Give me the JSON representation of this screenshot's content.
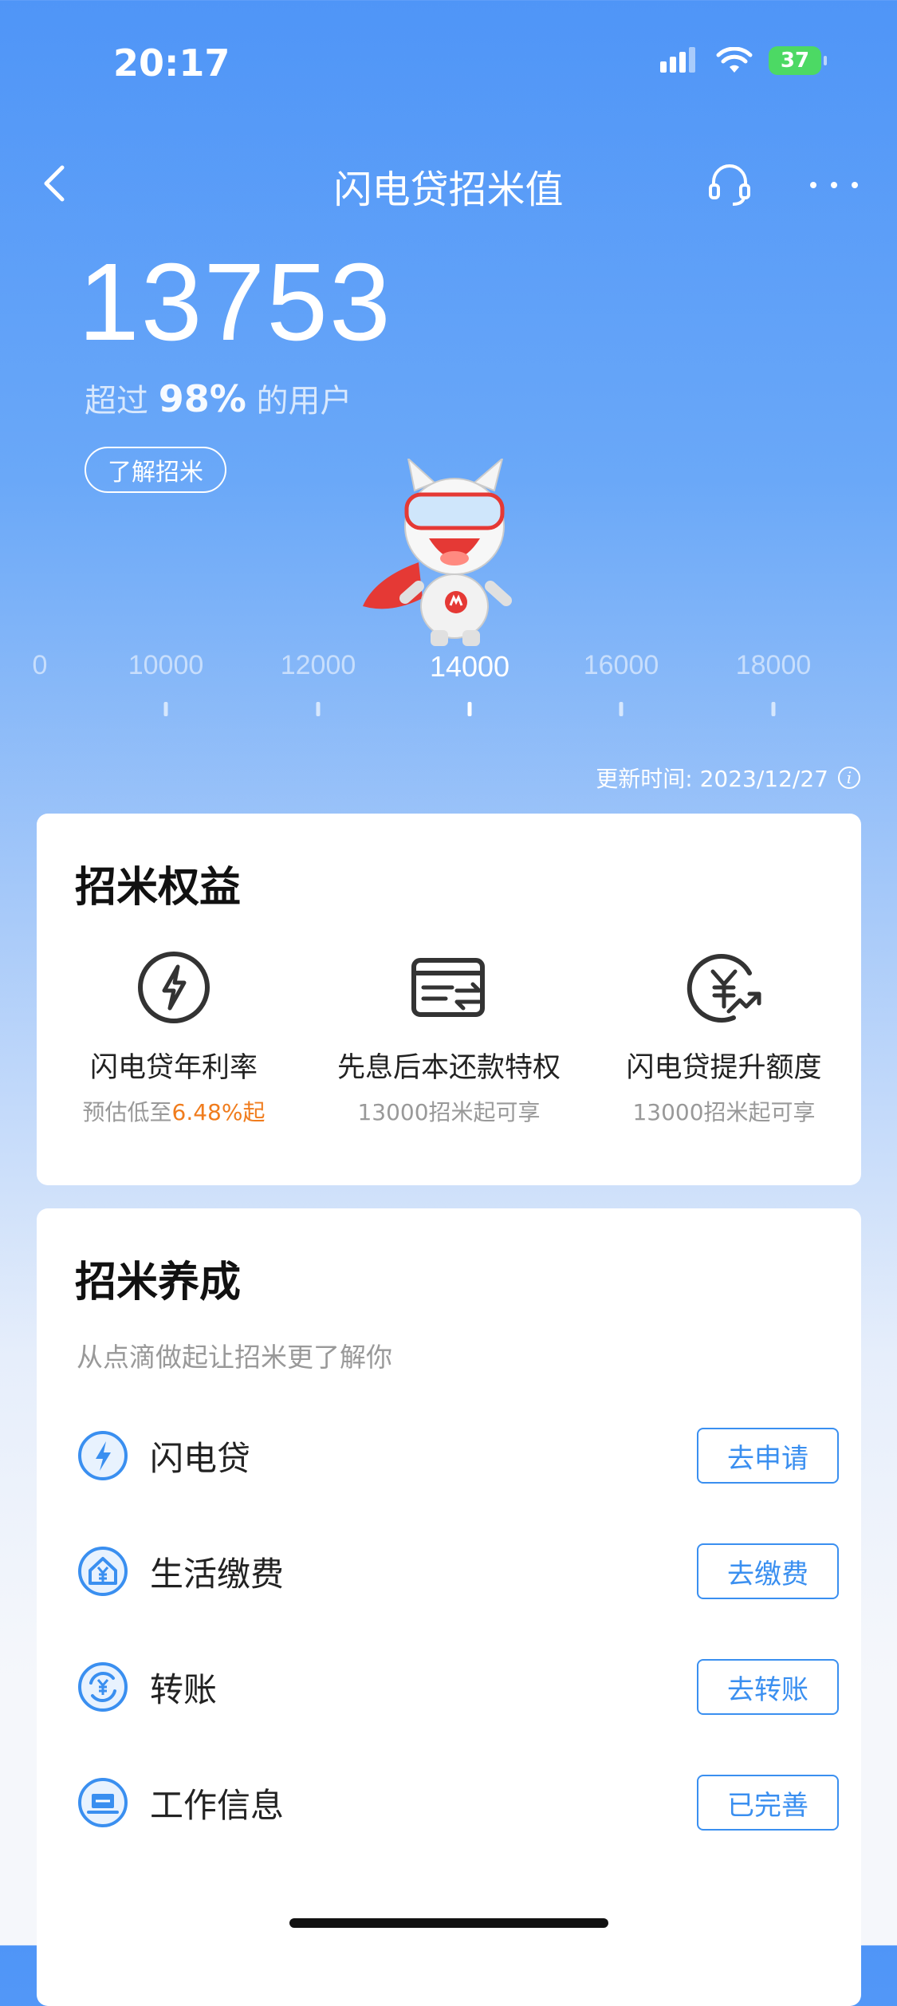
{
  "status_bar": {
    "time": "20:17",
    "battery": "37"
  },
  "nav": {
    "title": "闪电贷招米值",
    "back_icon": "chevron-left-icon",
    "service_icon": "headset-icon",
    "more_icon": "more-dots-icon"
  },
  "score": {
    "value": "13753",
    "percent_prefix": "超过 ",
    "percent_value": "98%",
    "percent_suffix": " 的用户",
    "learn_button": "了解招米"
  },
  "scale": {
    "labels": [
      "0",
      "10000",
      "12000",
      "14000",
      "16000",
      "18000"
    ],
    "active_label": "14000"
  },
  "update_time": "更新时间: 2023/12/27",
  "benefits": {
    "title": "招米权益",
    "items": [
      {
        "icon": "lightning-icon",
        "name": "闪电贷年利率",
        "sub_prefix": "预估低至",
        "sub_highlight": "6.48%起",
        "sub_suffix": ""
      },
      {
        "icon": "card-transfer-icon",
        "name": "先息后本还款特权",
        "sub_prefix": "13000招米起可享",
        "sub_highlight": "",
        "sub_suffix": ""
      },
      {
        "icon": "yen-increase-icon",
        "name": "闪电贷提升额度",
        "sub_prefix": "13000招米起可享",
        "sub_highlight": "",
        "sub_suffix": ""
      }
    ]
  },
  "growth": {
    "title": "招米养成",
    "subtitle": "从点滴做起让招米更了解你",
    "tasks": [
      {
        "icon": "lightning-icon",
        "label": "闪电贷",
        "button": "去申请"
      },
      {
        "icon": "house-yen-icon",
        "label": "生活缴费",
        "button": "去缴费"
      },
      {
        "icon": "transfer-yen-icon",
        "label": "转账",
        "button": "去转账"
      },
      {
        "icon": "laptop-icon",
        "label": "工作信息",
        "button": "已完善"
      }
    ]
  },
  "colors": {
    "accent": "#3a8ff0",
    "highlight": "#f07c1d",
    "header_bg": "#4f95f7"
  }
}
